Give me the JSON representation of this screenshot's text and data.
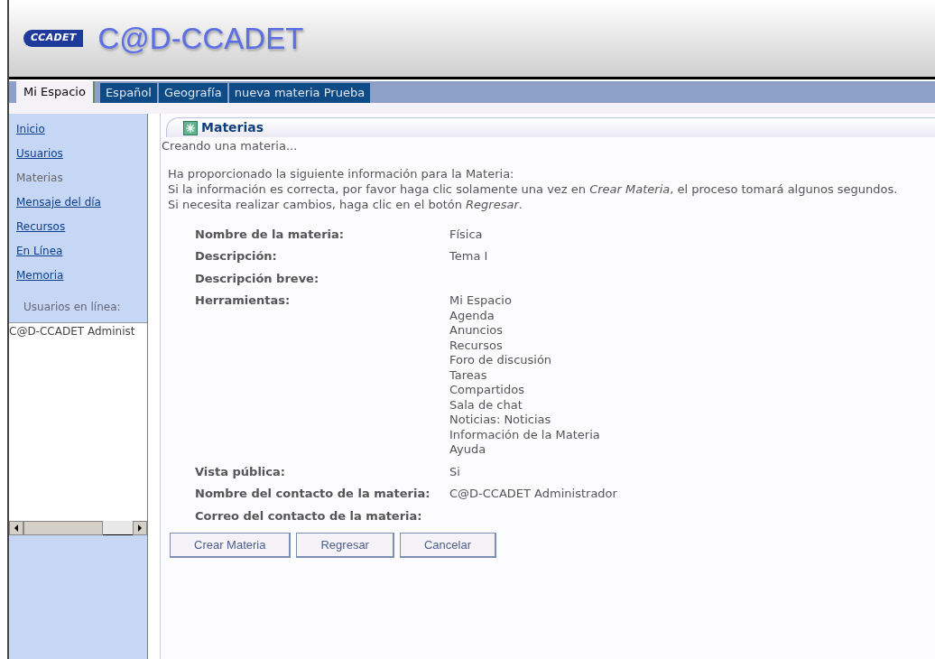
{
  "header": {
    "logo_text": "CCADET",
    "title": "C@D-CCADET"
  },
  "tabs": [
    {
      "label": "Mi Espacio",
      "selected": true
    },
    {
      "label": "Español",
      "selected": false
    },
    {
      "label": "Geografía",
      "selected": false
    },
    {
      "label": "nueva materia Prueba",
      "selected": false
    }
  ],
  "sidebar": {
    "items": [
      {
        "label": "Inicio",
        "selected": false
      },
      {
        "label": "Usuarios",
        "selected": false
      },
      {
        "label": "Materias",
        "selected": true
      },
      {
        "label": "Mensaje del día",
        "selected": false
      },
      {
        "label": "Recursos",
        "selected": false
      },
      {
        "label": "En Línea",
        "selected": false
      },
      {
        "label": "Memoria",
        "selected": false
      }
    ],
    "online_heading": "Usuarios en línea:",
    "online_users": [
      "C@D-CCADET Administ"
    ]
  },
  "panel": {
    "title": "Materias",
    "status": "Creando una materia...",
    "intro": [
      "Ha proporcionado la siguiente información para la Materia:",
      "Si la información es correcta, por favor haga clic solamente una vez en *Crear Materia*, el proceso tomará algunos segundos.",
      "Si necesita realizar cambios, haga clic en el botón *Regresar*."
    ],
    "fields": [
      {
        "label": "Nombre de la materia:",
        "values": [
          "Física"
        ]
      },
      {
        "label": "Descripción:",
        "values": [
          "Tema I"
        ]
      },
      {
        "label": "Descripción breve:"
      },
      {
        "label": "Herramientas:",
        "values": [
          "Mi Espacio",
          "Agenda",
          "Anuncios",
          "Recursos",
          "Foro de discusión",
          "Tareas",
          "Compartidos",
          "Sala de chat",
          "Noticias: Noticias",
          "Información de la Materia",
          "Ayuda"
        ]
      },
      {
        "label": "Vista pública:",
        "values": [
          "Si"
        ]
      },
      {
        "label": "Nombre del contacto de la materia:",
        "values": [
          "C@D-CCADET Administrador"
        ]
      },
      {
        "label": "Correo del contacto de la materia:"
      }
    ],
    "buttons": [
      "Crear Materia",
      "Regresar",
      "Cancelar"
    ]
  }
}
